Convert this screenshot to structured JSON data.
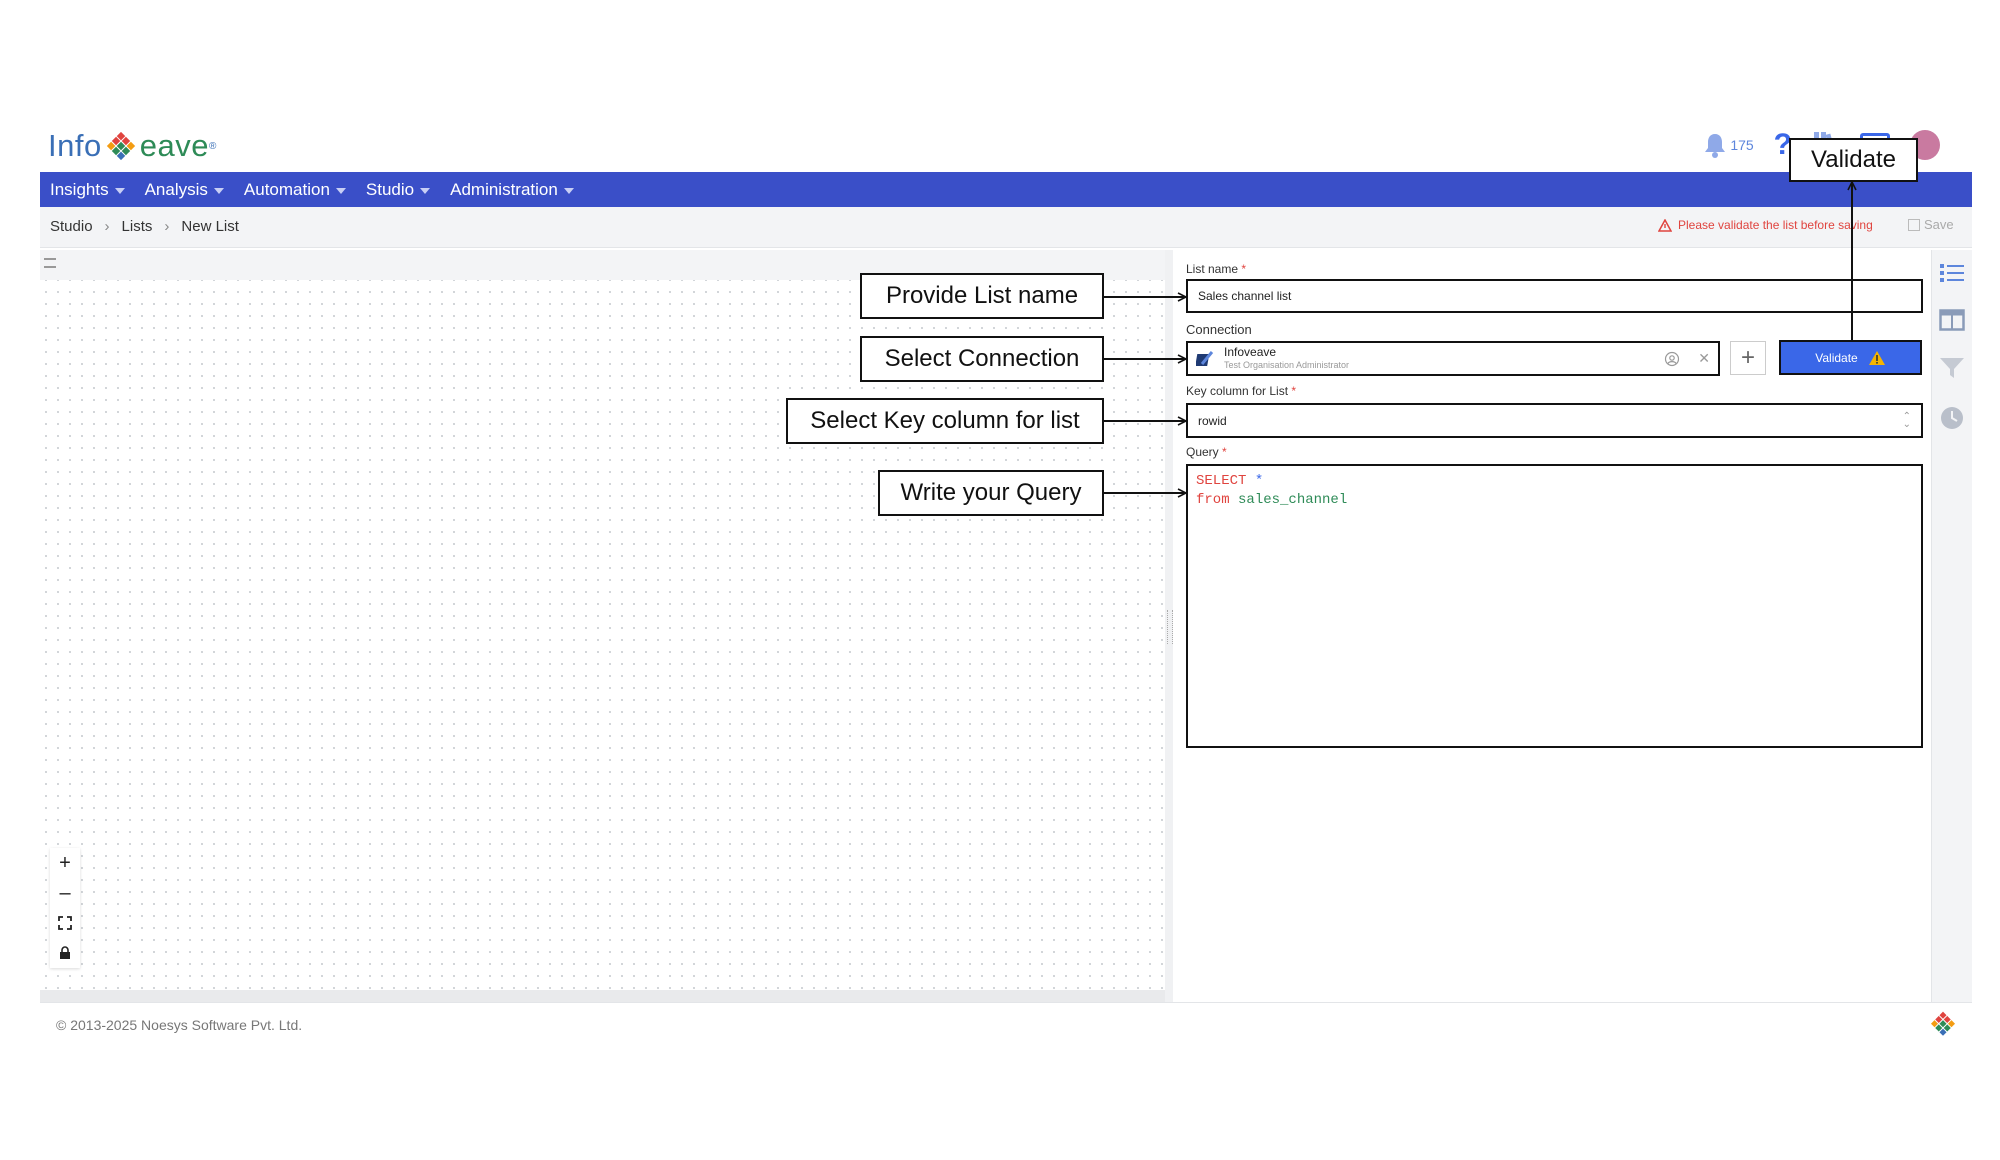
{
  "app": {
    "logo_text_left": "Info",
    "logo_text_right": "eave",
    "notifications_count": "175"
  },
  "nav": [
    {
      "label": "Insights"
    },
    {
      "label": "Analysis"
    },
    {
      "label": "Automation"
    },
    {
      "label": "Studio"
    },
    {
      "label": "Administration"
    }
  ],
  "breadcrumb": [
    "Studio",
    "Lists",
    "New List"
  ],
  "status": {
    "warning": "Please validate the list before saving",
    "save_label": "Save"
  },
  "form": {
    "list_name_label": "List name",
    "list_name_value": "Sales channel list",
    "connection_label": "Connection",
    "connection_name": "Infoveave",
    "connection_sub": "Test Organisation Administrator",
    "validate_label": "Validate",
    "key_column_label": "Key column for List",
    "key_column_value": "rowid",
    "query_label": "Query",
    "query_line1_keyword": "SELECT",
    "query_line1_rest": "*",
    "query_line2_keyword": "from",
    "query_line2_rest": "sales_channel"
  },
  "canvas_controls": {
    "zoom_in": "+",
    "zoom_out": "–",
    "fit": "⛶",
    "lock": "🔒"
  },
  "footer": {
    "copyright": "© 2013-2025 Noesys Software Pvt. Ltd."
  },
  "callouts": {
    "validate": "Validate",
    "list_name": "Provide List name",
    "connection": "Select Connection",
    "key_column": "Select Key column for list",
    "query": "Write your Query"
  },
  "colors": {
    "nav_bg": "#3a4fc8",
    "validate_bg": "#3a67e8",
    "warning": "#e0443f",
    "brand_blue": "#3a6fb6"
  }
}
